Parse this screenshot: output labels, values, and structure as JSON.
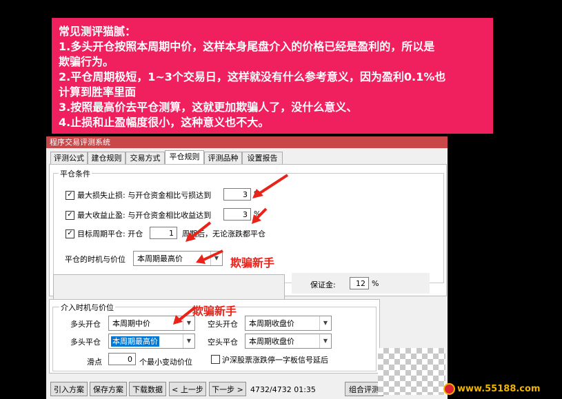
{
  "note": {
    "lines": [
      "常见测评猫腻：",
      "1.多头开仓按照本周期中价，这样本身尾盘介入的价格已经是盈利的，所以是",
      "欺骗行为。",
      "2.平仓周期极短，1~3个交易日，这样就没有什么参考意义，因为盈利0.1%也",
      "计算到胜率里面",
      "3.按照最高价去平仓测算，这就更加欺骗人了，没什么意义、",
      "4.止损和止盈幅度很小，这种意义也不大。"
    ]
  },
  "window": {
    "title": "程序交易评测系统",
    "tabs": [
      "评测公式",
      "建仓规则",
      "交易方式",
      "平仓规则",
      "评测品种",
      "设置报告"
    ],
    "active_tab": "平仓规则"
  },
  "close_conditions": {
    "group_title": "平仓条件",
    "stop_loss": {
      "checked": true,
      "label": "最大损失止损: 与开仓资金相比亏损达到",
      "value": "3",
      "unit": "%"
    },
    "take_profit": {
      "checked": true,
      "label": "最大收益止盈: 与开仓资金相比收益达到",
      "value": "3",
      "unit": "%"
    },
    "target_period": {
      "checked": true,
      "label": "目标周期平仓: 开仓",
      "value": "1",
      "suffix": "周期后，无论涨跌都平仓"
    },
    "timing_label": "平仓的时机与价位",
    "timing_value": "本周期最高价"
  },
  "margin": {
    "label": "保证金:",
    "value": "12",
    "unit": "%"
  },
  "entry": {
    "group_title": "介入时机与价位",
    "long_open_label": "多头开仓",
    "long_open_value": "本周期中价",
    "long_close_label": "多头平仓",
    "long_close_value": "本周期最高价",
    "short_open_label": "空头开仓",
    "short_open_value": "本周期收盘价",
    "short_close_label": "空头平仓",
    "short_close_value": "本周期收盘价",
    "slippage_label": "滑点",
    "slippage_value": "0",
    "slippage_unit": "个最小变动价位",
    "limit_label": "沪深股票涨跌停一字板信号延后",
    "limit_checked": false
  },
  "annotations": {
    "cheat_1": "欺骗新手",
    "cheat_2": "欺骗新手"
  },
  "buttons": {
    "import": "引入方案",
    "save": "保存方案",
    "download": "下载数据",
    "prev": "< 上一步",
    "next": "下一步 >",
    "status": "4732/4732  01:35",
    "combo": "组合评测"
  },
  "watermark": "www.55188.com",
  "colors": {
    "note_bg": "#f01f5e",
    "title_bar": "#c8484a",
    "annotation_red": "#e8231a",
    "selection": "#0078d7"
  }
}
